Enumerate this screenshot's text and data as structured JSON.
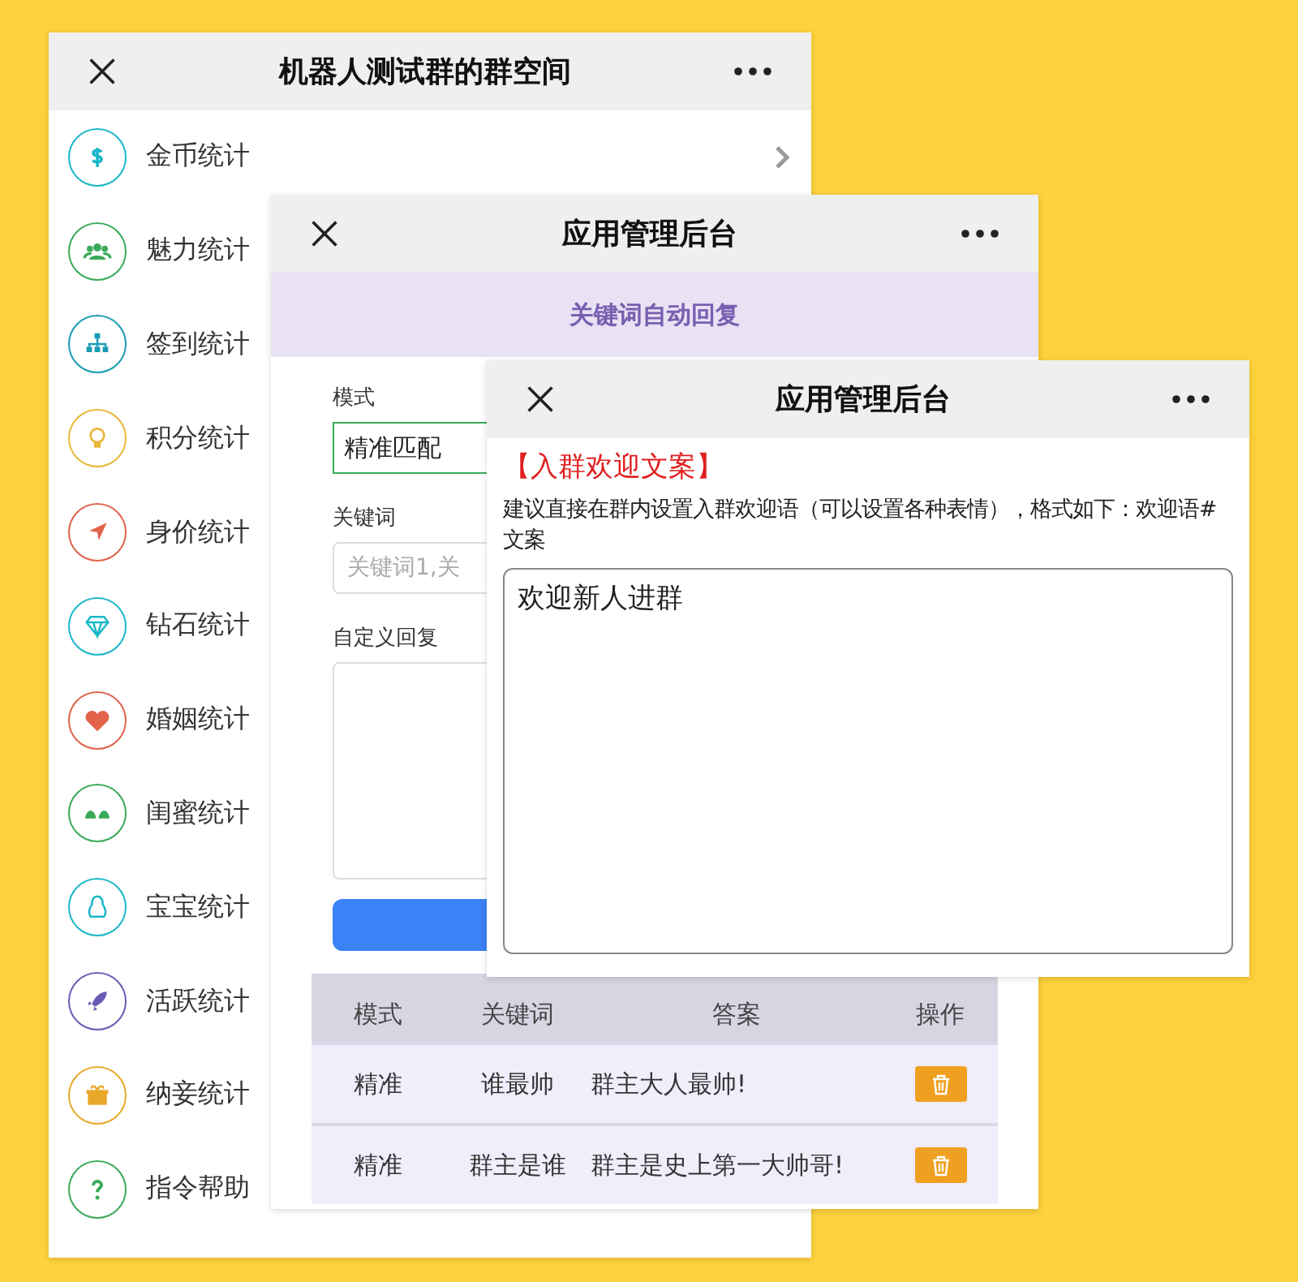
{
  "windows": [
    {
      "title": "机器人测试群的群空间",
      "items": [
        {
          "label": "金币统计",
          "color": "#1ab7c8"
        },
        {
          "label": "魅力统计",
          "color": "#3aaa5a"
        },
        {
          "label": "签到统计",
          "color": "#1a9bb5"
        },
        {
          "label": "积分统计",
          "color": "#e8b83a"
        },
        {
          "label": "身价统计",
          "color": "#e0634a"
        },
        {
          "label": "钻石统计",
          "color": "#1ab7c8"
        },
        {
          "label": "婚姻统计",
          "color": "#e0634a"
        },
        {
          "label": "闺蜜统计",
          "color": "#3aaa5a"
        },
        {
          "label": "宝宝统计",
          "color": "#1ab7c8"
        },
        {
          "label": "活跃统计",
          "color": "#6b5bb5"
        },
        {
          "label": "纳妾统计",
          "color": "#e8a92a"
        },
        {
          "label": "指令帮助",
          "color": "#3aaa5a"
        }
      ]
    },
    {
      "title": "应用管理后台",
      "banner": "关键词自动回复",
      "form": {
        "mode_label": "模式",
        "mode_value": "精准匹配",
        "keyword_label": "关键词",
        "keyword_placeholder": "关键词1,关",
        "reply_label": "自定义回复"
      },
      "table": {
        "columns": [
          "模式",
          "关键词",
          "答案",
          "操作"
        ],
        "rows": [
          {
            "mode": "精准",
            "keyword": "谁最帅",
            "answer": "群主大人最帅!"
          },
          {
            "mode": "精准",
            "keyword": "群主是谁",
            "answer": "群主是史上第一大帅哥!"
          }
        ]
      }
    },
    {
      "title": "应用管理后台",
      "heading": "【入群欢迎文案】",
      "description": "建议直接在群内设置入群欢迎语（可以设置各种表情），格式如下：欢迎语#文案",
      "value": "欢迎新人进群"
    }
  ]
}
